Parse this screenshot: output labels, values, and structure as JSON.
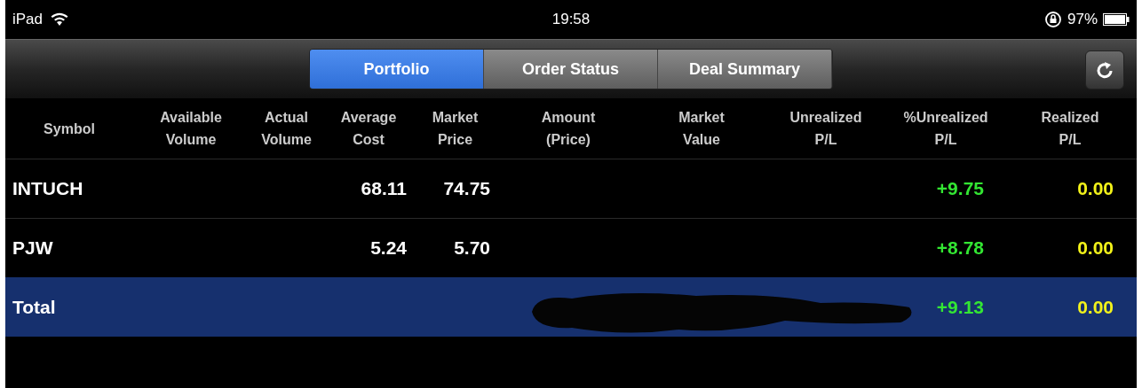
{
  "status_bar": {
    "device": "iPad",
    "time": "19:58",
    "battery": "97%"
  },
  "tabs": [
    {
      "label": "Portfolio",
      "selected": true
    },
    {
      "label": "Order Status",
      "selected": false
    },
    {
      "label": "Deal Summary",
      "selected": false
    }
  ],
  "table": {
    "columns": [
      "Symbol",
      "Available\nVolume",
      "Actual\nVolume",
      "Average\nCost",
      "Market\nPrice",
      "Amount\n(Price)",
      "Market\nValue",
      "Unrealized\nP/L",
      "%Unrealized\nP/L",
      "Realized\nP/L"
    ],
    "rows": [
      {
        "kind": "holding",
        "symbol": "INTUCH",
        "average_cost": "68.11",
        "market_price": "74.75",
        "pct_unrealized_pl": "+9.75",
        "realized_pl": "0.00"
      },
      {
        "kind": "holding",
        "symbol": "PJW",
        "average_cost": "5.24",
        "market_price": "5.70",
        "pct_unrealized_pl": "+8.78",
        "realized_pl": "0.00"
      },
      {
        "kind": "total",
        "symbol": "Total",
        "pct_unrealized_pl": "+9.13",
        "realized_pl": "0.00"
      }
    ]
  }
}
